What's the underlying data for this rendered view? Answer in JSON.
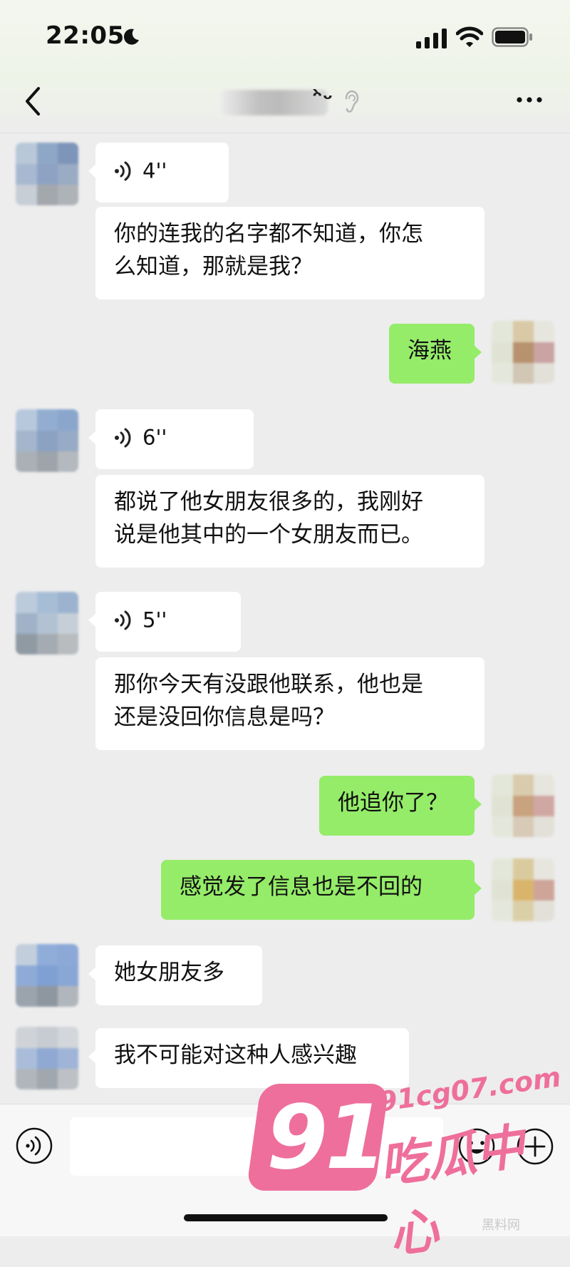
{
  "status_bar": {
    "time": "22:05"
  },
  "header": {
    "title": "ᵔ̀ᵕ"
  },
  "messages": [
    {
      "side": "left",
      "type": "voice",
      "duration": "4''"
    },
    {
      "side": "left",
      "type": "text",
      "lines": [
        "你的连我的名字都不知道，你怎",
        "么知道，那就是我？"
      ]
    },
    {
      "side": "right",
      "type": "text",
      "lines": [
        "海燕"
      ]
    },
    {
      "side": "left",
      "type": "voice",
      "duration": "6''"
    },
    {
      "side": "left",
      "type": "text",
      "lines": [
        "都说了他女朋友很多的，我刚好",
        "说是他其中的一个女朋友而已。"
      ]
    },
    {
      "side": "left",
      "type": "voice",
      "duration": "5''"
    },
    {
      "side": "left",
      "type": "text",
      "lines": [
        "那你今天有没跟他联系，他也是",
        "还是没回你信息是吗？"
      ]
    },
    {
      "side": "right",
      "type": "text",
      "lines": [
        "他追你了？"
      ]
    },
    {
      "side": "right",
      "type": "text",
      "lines": [
        "感觉发了信息也是不回的"
      ]
    },
    {
      "side": "left",
      "type": "text",
      "lines": [
        "她女朋友多"
      ]
    },
    {
      "side": "left",
      "type": "text",
      "lines": [
        "我不可能对这种人感兴趣"
      ]
    }
  ],
  "input_bar": {
    "placeholder": ""
  },
  "watermark": {
    "number": "91",
    "site": "91cg07.com",
    "name": "吃瓜中心",
    "corner": "黑料网"
  },
  "icons": {
    "back": "chevron-left-icon",
    "more": "more-dots-icon",
    "voice": "voice-wave-icon",
    "emoji": "smiley-icon",
    "plus": "plus-circle-icon",
    "ear": "ear-icon"
  },
  "colors": {
    "background": "#ededed",
    "sent_bubble": "#95ec69",
    "received_bubble": "#ffffff",
    "watermark": "#ee6f9b"
  }
}
